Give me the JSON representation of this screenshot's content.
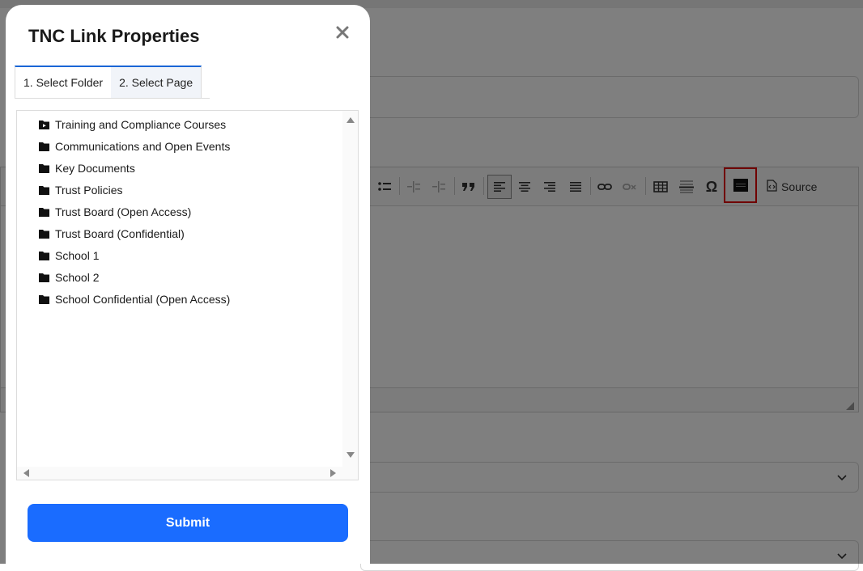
{
  "modal": {
    "title": "TNC Link Properties",
    "close_icon": "close-icon",
    "submit_label": "Submit"
  },
  "tabs": [
    {
      "label": "1. Select Folder",
      "active": true
    },
    {
      "label": "2. Select Page",
      "active": false
    }
  ],
  "tree": {
    "items": [
      {
        "label": "Training and Compliance Courses",
        "icon": "video-folder-icon"
      },
      {
        "label": "Communications and Open Events",
        "icon": "folder-icon"
      },
      {
        "label": "Key Documents",
        "icon": "folder-icon"
      },
      {
        "label": "Trust Policies",
        "icon": "folder-icon"
      },
      {
        "label": "Trust Board (Open Access)",
        "icon": "folder-icon"
      },
      {
        "label": "Trust Board (Confidential)",
        "icon": "folder-icon"
      },
      {
        "label": "School 1",
        "icon": "folder-icon"
      },
      {
        "label": "School 2",
        "icon": "folder-icon"
      },
      {
        "label": "School Confidential (Open Access)",
        "icon": "folder-icon"
      }
    ]
  },
  "editor": {
    "source_label": "Source"
  },
  "colors": {
    "primary": "#1a6cff",
    "tab_accent": "#1a66d6",
    "highlight": "#e00000"
  }
}
